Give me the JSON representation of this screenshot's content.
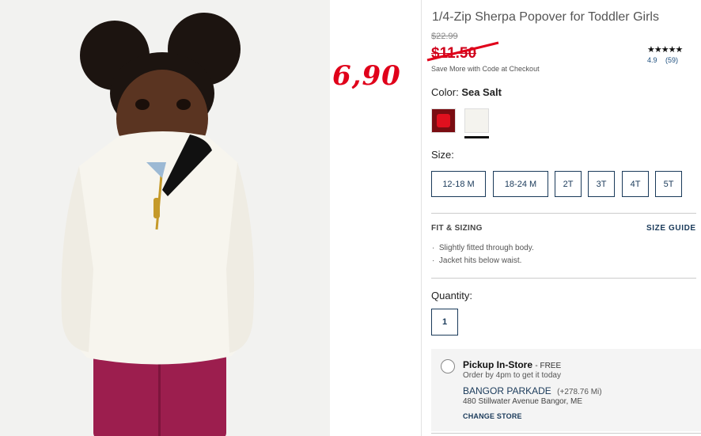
{
  "overlay": {
    "handwritten_price": "6,90"
  },
  "product": {
    "title": "1/4-Zip Sherpa Popover for Toddler Girls",
    "original_price": "$22.99",
    "sale_price": "$11.50",
    "save_more": "Save More with Code at Checkout",
    "rating": {
      "stars": "★★★★★",
      "score": "4.9",
      "count": "(59)"
    }
  },
  "color": {
    "label": "Color:",
    "selected": "Sea Salt",
    "swatches": [
      {
        "name": "red-swatch",
        "color": "#e0101e"
      },
      {
        "name": "sea-salt-swatch",
        "color": "#f4f3ee",
        "selected": true
      }
    ]
  },
  "size": {
    "label": "Size:",
    "options": [
      "12-18 M",
      "18-24 M",
      "2T",
      "3T",
      "4T",
      "5T"
    ]
  },
  "fit": {
    "heading": "FIT & SIZING",
    "size_guide": "SIZE GUIDE",
    "items": [
      "Slightly fitted through body.",
      "Jacket hits below waist."
    ]
  },
  "quantity": {
    "label": "Quantity:",
    "value": "1"
  },
  "pickup": {
    "title": "Pickup In-Store",
    "free": "- FREE",
    "order_by": "Order by 4pm to get it today",
    "store_name": "BANGOR PARKADE",
    "distance": "(+278.76 Mi)",
    "address": "480 Stillwater Avenue Bangor, ME",
    "change_store": "CHANGE STORE"
  },
  "colors": {
    "accent_navy": "#1a3a5a",
    "sale_red": "#d0021b",
    "overlay_red": "#e0001a"
  }
}
